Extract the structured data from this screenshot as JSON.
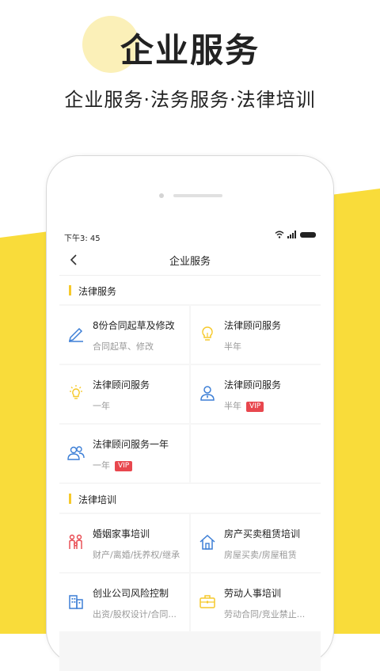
{
  "hero": {
    "title": "企业服务",
    "subtitle": "企业服务·法务服务·法律培训"
  },
  "status": {
    "time": "下午3: 45"
  },
  "nav": {
    "title": "企业服务"
  },
  "sections": [
    {
      "title": "法律服务",
      "items": [
        {
          "title": "8份合同起草及修改",
          "desc": "合同起草、修改",
          "icon": "pencil-icon"
        },
        {
          "title": "法律顾问服务",
          "desc": "半年",
          "icon": "lightbulb-icon"
        },
        {
          "title": "法律顾问服务",
          "desc": "一年",
          "icon": "lightbulb-glow-icon"
        },
        {
          "title": "法律顾问服务",
          "desc": "半年",
          "badge": "VIP",
          "icon": "user-icon"
        },
        {
          "title": "法律顾问服务一年",
          "desc": "一年",
          "badge": "VIP",
          "icon": "users-icon"
        }
      ]
    },
    {
      "title": "法律培训",
      "items": [
        {
          "title": "婚姻家事培训",
          "desc": "财产/离婚/抚养权/继承",
          "icon": "family-icon"
        },
        {
          "title": "房产买卖租赁培训",
          "desc": "房屋买卖/房屋租赁",
          "icon": "house-icon"
        },
        {
          "title": "创业公司风险控制",
          "desc": "出资/股权设计/合同...",
          "icon": "building-icon"
        },
        {
          "title": "劳动人事培训",
          "desc": "劳动合同/竞业禁止...",
          "icon": "briefcase-icon"
        }
      ]
    }
  ],
  "colors": {
    "accent_yellow": "#f9dc3a",
    "vip_red": "#e8474e",
    "icon_blue": "#3d7fd6",
    "icon_yellow": "#f6c92b",
    "icon_red": "#e8474e"
  }
}
